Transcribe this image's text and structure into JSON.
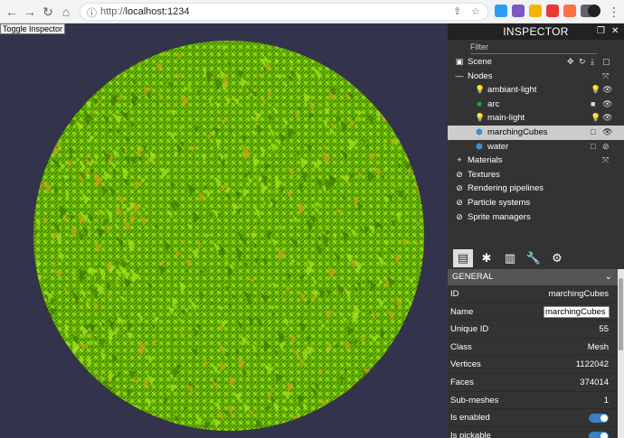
{
  "browser": {
    "url_prefix": "http://",
    "url_host": "localhost:1234",
    "icons": [
      "back-icon",
      "forward-icon",
      "reload-icon",
      "home-icon",
      "info-icon",
      "share-icon",
      "star-icon"
    ],
    "extensions": [
      "#2a9df4",
      "#7e57c2",
      "#f4b400",
      "#e53935",
      "#ff7043",
      "#5f6368"
    ]
  },
  "viewport": {
    "toggle_label": "Toggle Inspector",
    "mesh_color": "#6ec000",
    "mesh_dark": "#3f7a00",
    "mesh_light": "#a6e31b",
    "background": "#33334c"
  },
  "inspector": {
    "title": "INSPECTOR",
    "filter_placeholder": "Filter",
    "tree": [
      {
        "id": "scene",
        "label": "Scene",
        "indent": 0,
        "icon": "▣",
        "actions": [
          "✥",
          "↻",
          "⤓",
          "▢"
        ]
      },
      {
        "id": "nodes",
        "label": "Nodes",
        "indent": 0,
        "icon": "—",
        "actions": [
          "⤧"
        ]
      },
      {
        "id": "ambiant-light",
        "label": "ambiant-light",
        "indent": 1,
        "icon": "💡",
        "icon_color": "#f0d000",
        "actions": [
          "💡",
          "👁"
        ]
      },
      {
        "id": "arc",
        "label": "arc",
        "indent": 1,
        "icon": "■",
        "icon_color": "#2aa136",
        "actions": [
          "■",
          "👁"
        ]
      },
      {
        "id": "main-light",
        "label": "main-light",
        "indent": 1,
        "icon": "💡",
        "icon_color": "#f0d000",
        "actions": [
          "💡",
          "👁"
        ]
      },
      {
        "id": "marchingCubes",
        "label": "marchingCubes",
        "indent": 1,
        "icon": "⬢",
        "icon_color": "#3a8fd8",
        "actions": [
          "□",
          "👁"
        ],
        "selected": true
      },
      {
        "id": "water",
        "label": "water",
        "indent": 1,
        "icon": "⬢",
        "icon_color": "#3a8fd8",
        "actions": [
          "□",
          "⊘"
        ]
      },
      {
        "id": "materials",
        "label": "Materials",
        "indent": 0,
        "icon": "+",
        "actions": [
          "⤧"
        ]
      },
      {
        "id": "textures",
        "label": "Textures",
        "indent": 0,
        "icon": "⊘",
        "actions": []
      },
      {
        "id": "rendering-pipelines",
        "label": "Rendering pipelines",
        "indent": 0,
        "icon": "⊘",
        "actions": []
      },
      {
        "id": "particle-systems",
        "label": "Particle systems",
        "indent": 0,
        "icon": "⊘",
        "actions": []
      },
      {
        "id": "sprite-managers",
        "label": "Sprite managers",
        "indent": 0,
        "icon": "⊘",
        "actions": []
      }
    ],
    "tabs": [
      {
        "name": "properties-tab",
        "glyph": "▤",
        "active": true
      },
      {
        "name": "debug-tab",
        "glyph": "✱",
        "active": false
      },
      {
        "name": "statistics-tab",
        "glyph": "▥",
        "active": false
      },
      {
        "name": "tools-tab",
        "glyph": "🔧",
        "active": false
      },
      {
        "name": "settings-tab",
        "glyph": "⚙",
        "active": false
      }
    ],
    "general": {
      "header": "GENERAL",
      "rows": [
        {
          "key": "ID",
          "value": "marchingCubes",
          "kind": "text"
        },
        {
          "key": "Name",
          "value": "marchingCubes",
          "kind": "input"
        },
        {
          "key": "Unique ID",
          "value": "55",
          "kind": "text"
        },
        {
          "key": "Class",
          "value": "Mesh",
          "kind": "text"
        },
        {
          "key": "Vertices",
          "value": "1122042",
          "kind": "text"
        },
        {
          "key": "Faces",
          "value": "374014",
          "kind": "text"
        },
        {
          "key": "Sub-meshes",
          "value": "1",
          "kind": "text"
        },
        {
          "key": "Is enabled",
          "value": "",
          "kind": "switch"
        },
        {
          "key": "Is pickable",
          "value": "",
          "kind": "switch"
        }
      ]
    }
  }
}
